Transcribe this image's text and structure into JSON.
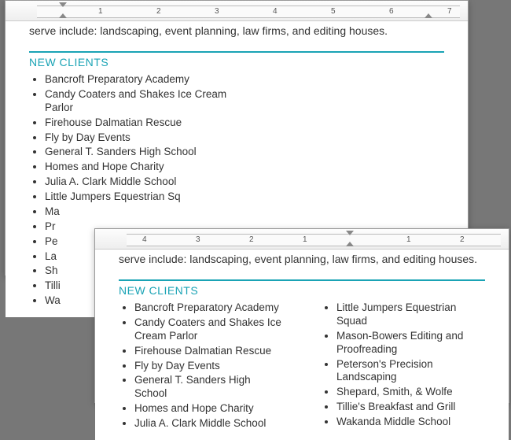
{
  "doc": {
    "intro_text": "serve include: landscaping, event planning, law firms, and editing houses.",
    "heading": "NEW CLIENTS",
    "clients_single": [
      "Bancroft Preparatory Academy",
      "Candy Coaters and Shakes Ice Cream Parlor",
      "Firehouse Dalmatian Rescue",
      "Fly by Day Events",
      "General T. Sanders High School",
      "Homes and Hope Charity",
      "Julia A. Clark Middle School",
      "Little Jumpers Equestrian Sq",
      "Ma",
      "Pr",
      "Pe",
      "La",
      "Sh",
      "Tilli",
      "Wa"
    ],
    "clients_col1": [
      "Bancroft Preparatory Academy",
      "Candy Coaters and Shakes Ice Cream Parlor",
      "Firehouse Dalmatian Rescue",
      "Fly by Day Events",
      "General T. Sanders High School",
      "Homes and Hope Charity",
      "Julia A. Clark Middle School"
    ],
    "clients_col2": [
      "Little Jumpers Equestrian Squad",
      "Mason-Bowers Editing and Proofreading",
      "Peterson's Precision Landscaping",
      "Shepard, Smith, & Wolfe",
      "Tillie's Breakfast and Grill",
      "Wakanda Middle School"
    ]
  },
  "ruler_back": {
    "numbers": [
      1,
      2,
      3,
      4,
      5,
      6,
      7
    ]
  },
  "ruler_front": {
    "numbers": [
      4,
      3,
      2,
      1,
      1,
      2
    ]
  }
}
